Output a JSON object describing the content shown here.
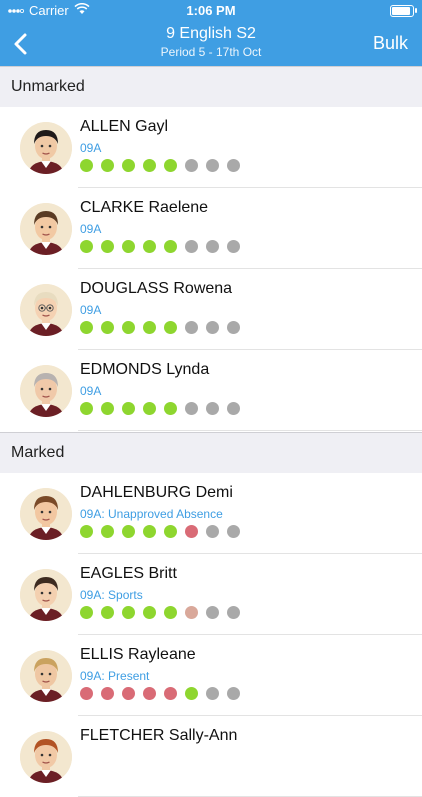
{
  "status": {
    "carrier": "Carrier",
    "time": "1:06 PM",
    "battery_level": 1.0
  },
  "nav": {
    "title": "9 English S2",
    "subtitle": "Period 5 - 17th Oct",
    "bulk_label": "Bulk"
  },
  "colors": {
    "present": "#8ed62f",
    "absent": "#d96b76",
    "empty": "#a9a9a9",
    "other": "#d9a89a",
    "accent": "#3f9ee3"
  },
  "sections": [
    {
      "label": "Unmarked"
    },
    {
      "label": "Marked"
    }
  ],
  "students": [
    {
      "name": "ALLEN Gayl",
      "sub": "09A",
      "dots": [
        "present",
        "present",
        "present",
        "present",
        "present",
        "empty",
        "empty",
        "empty"
      ],
      "hair": "#1f1a1a",
      "skin": "#f0c9a5",
      "glasses": false
    },
    {
      "name": "CLARKE Raelene",
      "sub": "09A",
      "dots": [
        "present",
        "present",
        "present",
        "present",
        "present",
        "empty",
        "empty",
        "empty"
      ],
      "hair": "#5a3b24",
      "skin": "#f2c9a3",
      "glasses": false
    },
    {
      "name": "DOUGLASS Rowena",
      "sub": "09A",
      "dots": [
        "present",
        "present",
        "present",
        "present",
        "present",
        "empty",
        "empty",
        "empty"
      ],
      "hair": "#e8dcc0",
      "skin": "#f5d2b3",
      "glasses": true
    },
    {
      "name": "EDMONDS Lynda",
      "sub": "09A",
      "dots": [
        "present",
        "present",
        "present",
        "present",
        "present",
        "empty",
        "empty",
        "empty"
      ],
      "hair": "#b7b2b0",
      "skin": "#f0c9a9",
      "glasses": false
    },
    {
      "name": "DAHLENBURG Demi",
      "sub": "09A: Unapproved Absence",
      "dots": [
        "present",
        "present",
        "present",
        "present",
        "present",
        "absent",
        "empty",
        "empty"
      ],
      "hair": "#7a4a28",
      "skin": "#f2c7a1",
      "glasses": false
    },
    {
      "name": "EAGLES Britt",
      "sub": "09A: Sports",
      "dots": [
        "present",
        "present",
        "present",
        "present",
        "present",
        "other",
        "empty",
        "empty"
      ],
      "hair": "#3d2b20",
      "skin": "#f3d0b0",
      "glasses": false
    },
    {
      "name": "ELLIS Rayleane",
      "sub": "09A: Present",
      "dots": [
        "absent",
        "absent",
        "absent",
        "absent",
        "absent",
        "present",
        "empty",
        "empty"
      ],
      "hair": "#caa25f",
      "skin": "#efc7a3",
      "glasses": false
    },
    {
      "name": "FLETCHER Sally-Ann",
      "sub": "",
      "dots": [],
      "hair": "#b25325",
      "skin": "#f1c9a6",
      "glasses": false
    }
  ]
}
